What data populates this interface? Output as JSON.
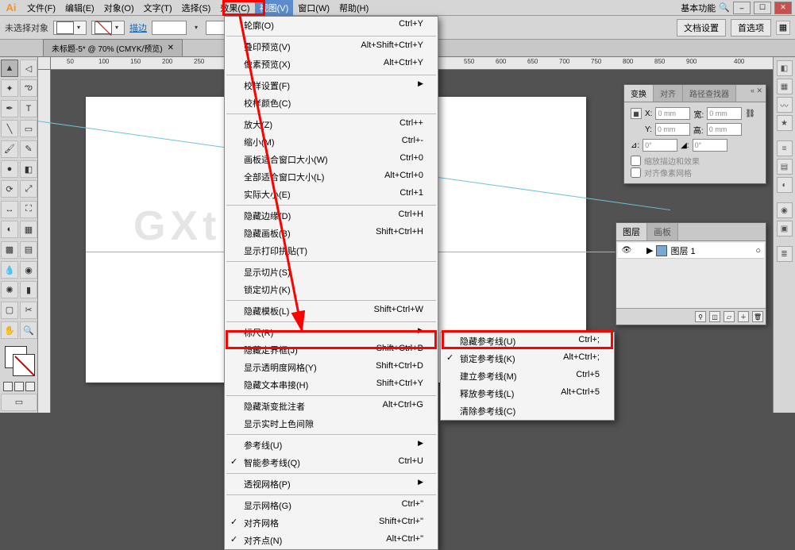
{
  "app": {
    "abbr": "Ai"
  },
  "menubar": {
    "items": [
      "文件(F)",
      "编辑(E)",
      "对象(O)",
      "文字(T)",
      "选择(S)",
      "效果(C)",
      "视图(V)",
      "窗口(W)",
      "帮助(H)"
    ],
    "right_label": "基本功能"
  },
  "controlbar": {
    "left_label": "未选择对象",
    "stroke_link": "描边",
    "doc_setup": "文档设置",
    "prefs": "首选项"
  },
  "doc": {
    "tab": "未标题-5* @ 70% (CMYK/预览)"
  },
  "ruler": [
    "50",
    "100",
    "150",
    "200",
    "250",
    "550",
    "600",
    "650",
    "700",
    "750",
    "800",
    "850",
    "900",
    "400"
  ],
  "transform_panel": {
    "tabs": [
      "变换",
      "对齐",
      "路径查找器"
    ],
    "x": "0 mm",
    "y": "0 mm",
    "w": "0 mm",
    "h": "0 mm",
    "rotate": "0°",
    "shear": "0°",
    "opt1": "缩放描边和效果",
    "opt2": "对齐像素网格"
  },
  "layer_panel": {
    "tabs": [
      "图层",
      "画板"
    ],
    "row": "图层 1"
  },
  "view_menu": [
    {
      "l": "轮廓(O)",
      "s": "Ctrl+Y"
    },
    {
      "sep": true
    },
    {
      "l": "叠印预览(V)",
      "s": "Alt+Shift+Ctrl+Y"
    },
    {
      "l": "像素预览(X)",
      "s": "Alt+Ctrl+Y"
    },
    {
      "sep": true
    },
    {
      "l": "校样设置(F)",
      "arrow": true
    },
    {
      "l": "校样颜色(C)"
    },
    {
      "sep": true
    },
    {
      "l": "放大(Z)",
      "s": "Ctrl++"
    },
    {
      "l": "缩小(M)",
      "s": "Ctrl+-"
    },
    {
      "l": "画板适合窗口大小(W)",
      "s": "Ctrl+0"
    },
    {
      "l": "全部适合窗口大小(L)",
      "s": "Alt+Ctrl+0"
    },
    {
      "l": "实际大小(E)",
      "s": "Ctrl+1"
    },
    {
      "sep": true
    },
    {
      "l": "隐藏边缘(D)",
      "s": "Ctrl+H"
    },
    {
      "l": "隐藏画板(B)",
      "s": "Shift+Ctrl+H"
    },
    {
      "l": "显示打印拼贴(T)"
    },
    {
      "sep": true
    },
    {
      "l": "显示切片(S)"
    },
    {
      "l": "锁定切片(K)"
    },
    {
      "sep": true
    },
    {
      "l": "隐藏模板(L)",
      "s": "Shift+Ctrl+W"
    },
    {
      "sep": true
    },
    {
      "l": "标尺(R)",
      "arrow": true
    },
    {
      "l": "隐藏定界框(J)",
      "s": "Shift+Ctrl+B"
    },
    {
      "l": "显示透明度网格(Y)",
      "s": "Shift+Ctrl+D"
    },
    {
      "l": "隐藏文本串接(H)",
      "s": "Shift+Ctrl+Y"
    },
    {
      "sep": true
    },
    {
      "l": "隐藏渐变批注者",
      "s": "Alt+Ctrl+G"
    },
    {
      "l": "显示实时上色间隙"
    },
    {
      "sep": true
    },
    {
      "l": "参考线(U)",
      "arrow": true
    },
    {
      "l": "智能参考线(Q)",
      "s": "Ctrl+U",
      "checked": true
    },
    {
      "sep": true
    },
    {
      "l": "透视网格(P)",
      "arrow": true
    },
    {
      "sep": true
    },
    {
      "l": "显示网格(G)",
      "s": "Ctrl+\""
    },
    {
      "l": "对齐网格",
      "s": "Shift+Ctrl+\"",
      "checked": true
    },
    {
      "l": "对齐点(N)",
      "s": "Alt+Ctrl+\"",
      "checked": true
    }
  ],
  "guides_submenu": [
    {
      "l": "隐藏参考线(U)",
      "s": "Ctrl+;"
    },
    {
      "l": "锁定参考线(K)",
      "s": "Alt+Ctrl+;",
      "checked": true
    },
    {
      "l": "建立参考线(M)",
      "s": "Ctrl+5"
    },
    {
      "l": "释放参考线(L)",
      "s": "Alt+Ctrl+5"
    },
    {
      "l": "清除参考线(C)"
    }
  ],
  "watermark": "GXt网"
}
